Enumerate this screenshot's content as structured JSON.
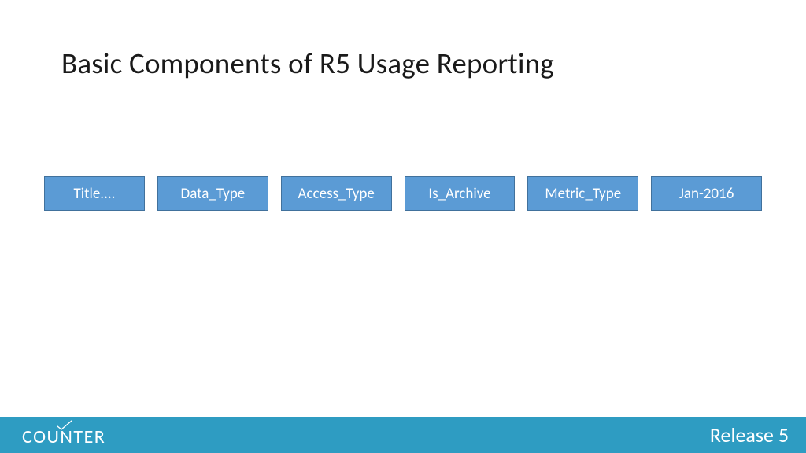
{
  "title": "Basic Components of R5 Usage Reporting",
  "boxes": {
    "b0": "Title....",
    "b1": "Data_Type",
    "b2": "Access_Type",
    "b3": "Is_Archive",
    "b4": "Metric_Type",
    "b5": "Jan-2016"
  },
  "footer": {
    "logo_text_pre": "COU",
    "logo_text_n": "N",
    "logo_text_post": "TER",
    "release": "Release 5"
  },
  "colors": {
    "box_fill": "#5b9bd5",
    "box_border": "#41719c",
    "footer": "#2e9cc2"
  }
}
